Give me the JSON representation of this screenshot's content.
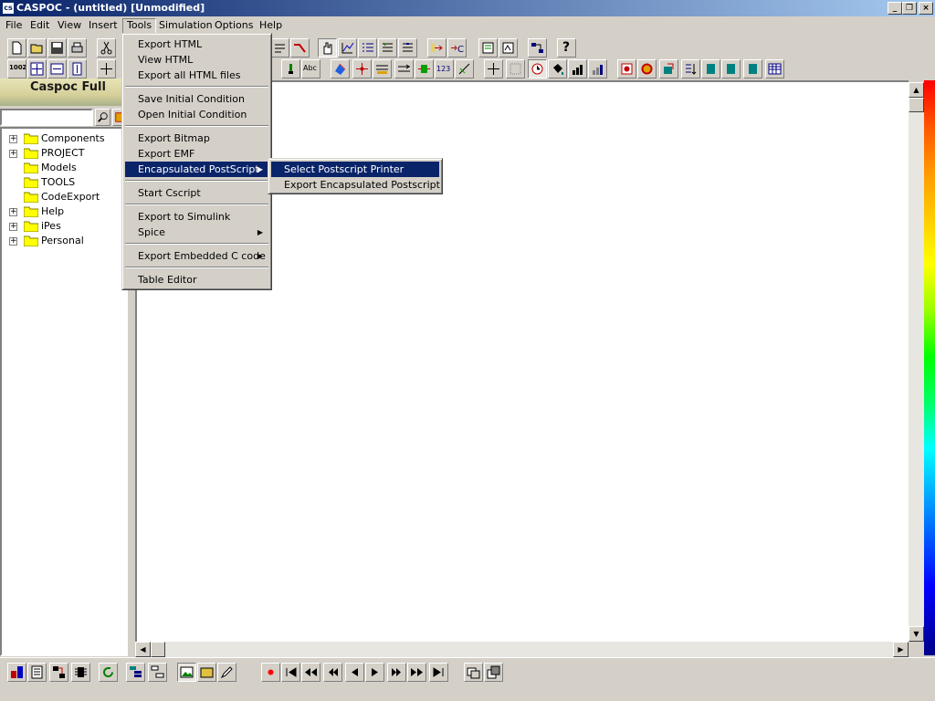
{
  "window": {
    "title": "CASPOC - (untitled) [Unmodified]",
    "app_icon": "cs",
    "controls": [
      "_",
      "❐",
      "×"
    ]
  },
  "menubar": {
    "items": [
      "File",
      "Edit",
      "View",
      "Insert",
      "Tools",
      "Simulation",
      "Options",
      "Help"
    ]
  },
  "tools_menu": {
    "items": [
      "Export HTML",
      "View HTML",
      "Export all HTML files",
      "Save Initial Condition",
      "Open Initial Condition",
      "Export Bitmap",
      "Export EMF",
      "Encapsulated PostScript",
      "Start Cscript",
      "Export to Simulink",
      "Spice",
      "Export Embedded C code",
      "Table Editor"
    ]
  },
  "submenu": {
    "items": [
      "Select Postscript Printer",
      "Export Encapsulated Postscript"
    ]
  },
  "left_panel": {
    "title": "Caspoc Full",
    "search_value": "",
    "zoom_label": "100Z",
    "tree": [
      {
        "label": "Components",
        "expandable": true
      },
      {
        "label": "PROJECT",
        "expandable": true
      },
      {
        "label": "Models",
        "expandable": false
      },
      {
        "label": "TOOLS",
        "expandable": false
      },
      {
        "label": "CodeExport",
        "expandable": false
      },
      {
        "label": "Help",
        "expandable": true
      },
      {
        "label": "iPes",
        "expandable": true
      },
      {
        "label": "Personal",
        "expandable": true
      }
    ]
  },
  "toolbar": {
    "help_icon": "?",
    "text_icon": "Abc",
    "counter_icon": "123"
  },
  "colors": {
    "titlebar": "#0a246a",
    "selection": "#0a246a",
    "face": "#d4d0c8"
  }
}
